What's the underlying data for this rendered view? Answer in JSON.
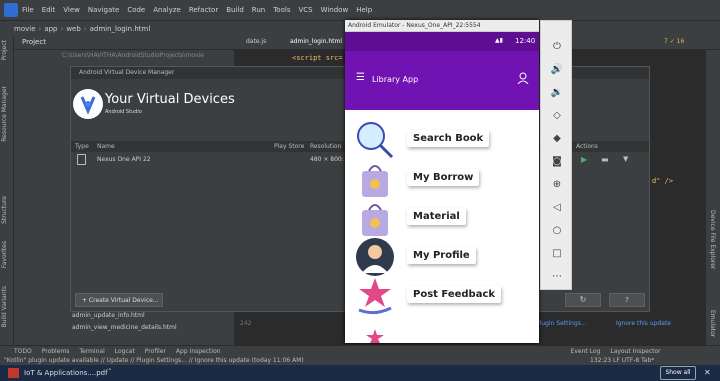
{
  "menu": [
    "File",
    "Edit",
    "View",
    "Navigate",
    "Code",
    "Analyze",
    "Refactor",
    "Build",
    "Run",
    "Tools",
    "VCS",
    "Window",
    "Help"
  ],
  "breadcrumb": [
    "movie",
    "app",
    "web",
    "admin_login.html"
  ],
  "project_label": "Project",
  "project_path": "C:\\Users\\HAVITHA\\AndroidStudioProjects\\movie",
  "editor_tabs": [
    "date.js",
    "admin_login.html"
  ],
  "code_line": "<script src=",
  "code_end": "d\" />",
  "inspections": "7  ✓ 16",
  "avd": {
    "window_title": "Android Virtual Device Manager",
    "heading": "Your Virtual Devices",
    "subheading": "Android Studio",
    "columns": [
      "Type",
      "Name",
      "Play Store",
      "Resolution",
      "Actions"
    ],
    "device_name": "Nexus One API 22",
    "resolution": "480 × 800: h",
    "create_button": "+ Create Virtual Device..."
  },
  "project_files": [
    "admin_update_info.html",
    "admin_view_medicine_details.html"
  ],
  "notification": {
    "plugin_settings": "Plugin Settings...",
    "ignore": "Ignore this update",
    "update": "Update"
  },
  "line_col": "242",
  "emulator": {
    "window_title": "Android Emulator - Nexus_One_API_22:5554",
    "clock": "12:40",
    "app_title": "Library App",
    "items": [
      "Search Book",
      "My Borrow",
      "Material",
      "My Profile",
      "Post Feedback"
    ]
  },
  "bottom_tabs": [
    "TODO",
    "Problems",
    "Terminal",
    "Logcat",
    "Profiler",
    "App Inspection",
    "Event Log",
    "Layout Inspector"
  ],
  "status_text": "\"Kotlin\" plugin update available // Update // Plugin Settings... // Ignore this update (today 11:06 AM)",
  "status_right": "132:23  LF  UTF-8  Tab*",
  "left_tools": [
    "Project",
    "Resource Manager",
    "Structure",
    "Favorites",
    "Build Variants"
  ],
  "right_tools": [
    "Device File Explorer",
    "Emulator"
  ],
  "taskbar": {
    "download": "IoT & Applications....pdf",
    "show_all": "Show all"
  },
  "colors": {
    "status_bar": "#5e0e93",
    "app_bar": "#7013b2",
    "ide_bg": "#2b2b2b"
  }
}
